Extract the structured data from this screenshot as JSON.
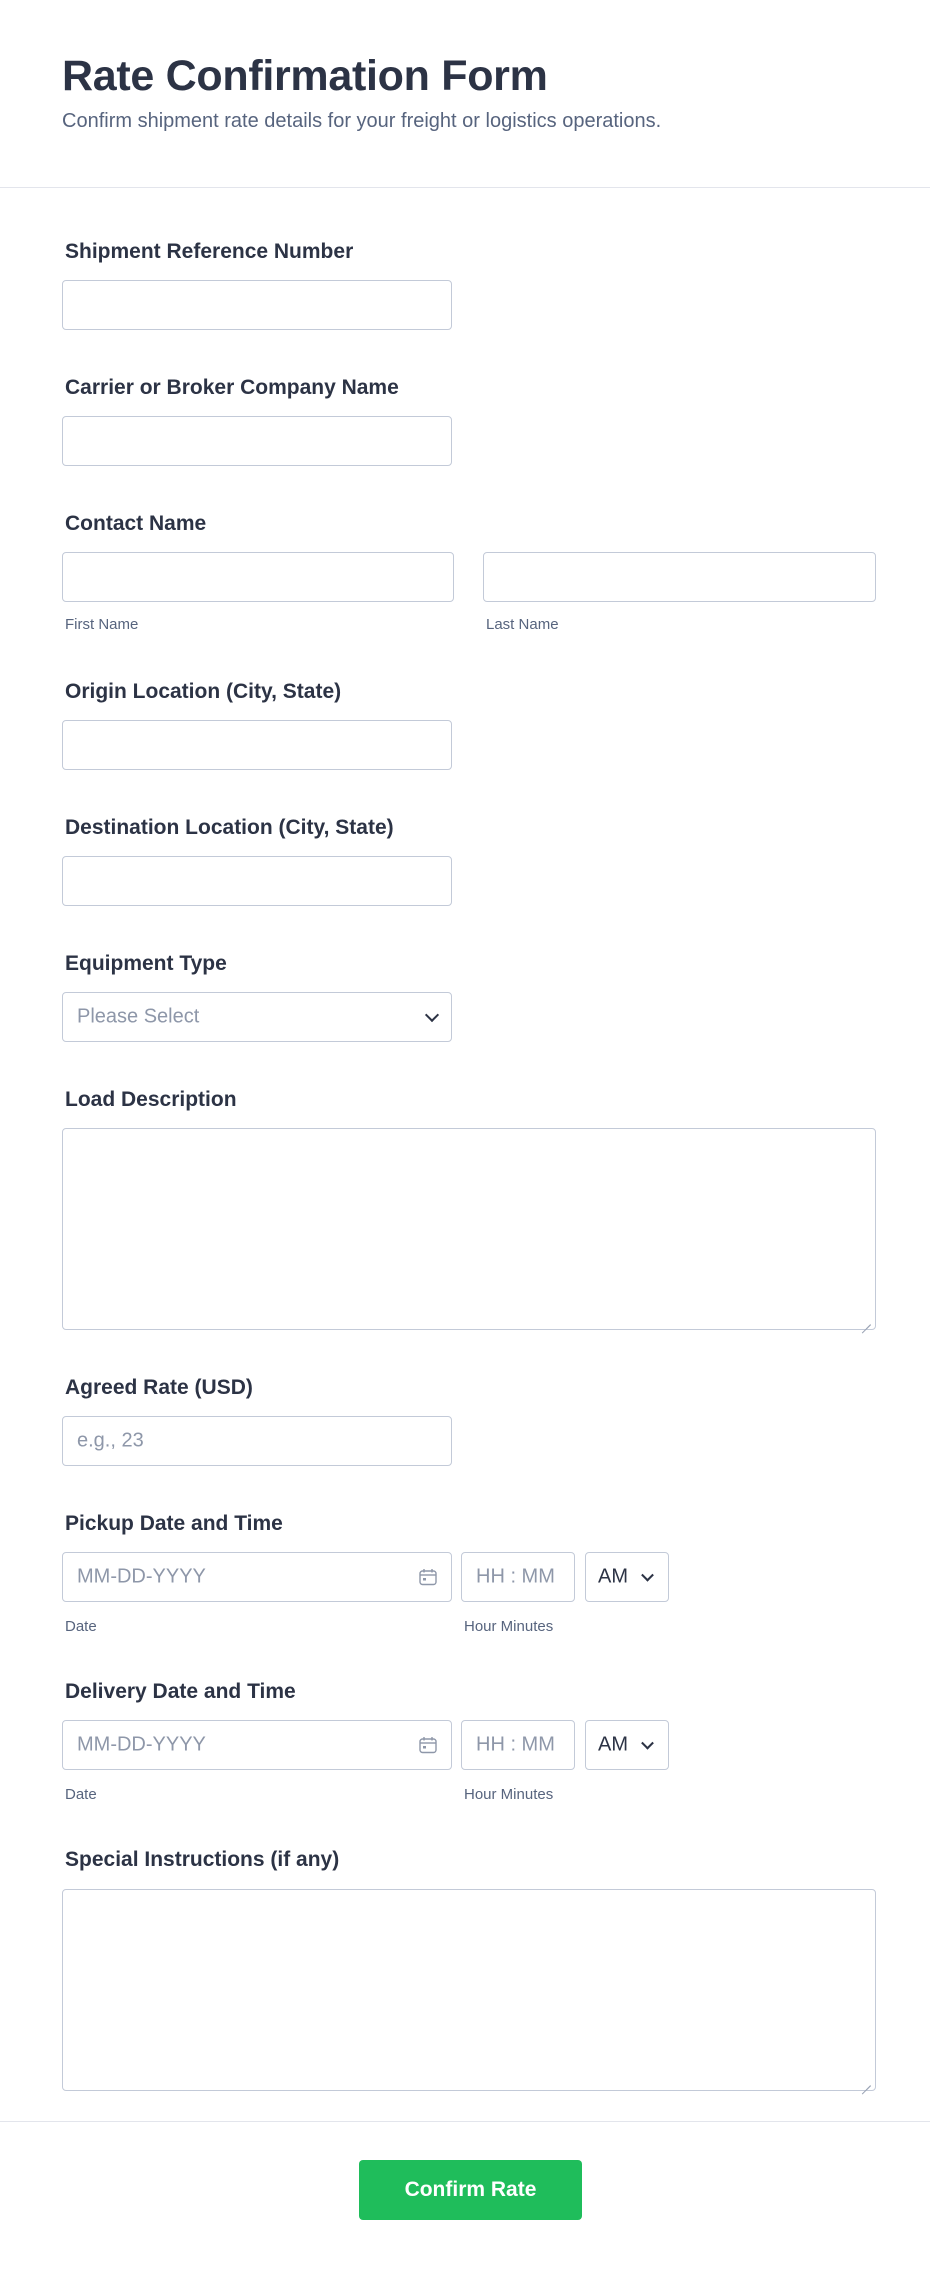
{
  "form": {
    "title": "Rate Confirmation Form",
    "subtitle": "Confirm shipment rate details for your freight or logistics operations."
  },
  "fields": {
    "shipment_ref": {
      "label": "Shipment Reference Number",
      "value": ""
    },
    "carrier": {
      "label": "Carrier or Broker Company Name",
      "value": ""
    },
    "contact": {
      "label": "Contact Name",
      "first_sublabel": "First Name",
      "last_sublabel": "Last Name",
      "first_value": "",
      "last_value": ""
    },
    "origin": {
      "label": "Origin Location (City, State)",
      "value": ""
    },
    "destination": {
      "label": "Destination Location (City, State)",
      "value": ""
    },
    "equipment": {
      "label": "Equipment Type",
      "placeholder": "Please Select",
      "icon": "chevron-down-icon"
    },
    "load_description": {
      "label": "Load Description",
      "value": ""
    },
    "agreed_rate": {
      "label": "Agreed Rate (USD)",
      "placeholder": "e.g., 23"
    },
    "pickup": {
      "label": "Pickup Date and Time",
      "date_placeholder": "MM-DD-YYYY",
      "time_placeholder": "HH : MM",
      "ampm": "AM",
      "date_sublabel": "Date",
      "time_sublabel": "Hour Minutes",
      "icon": "calendar-icon"
    },
    "delivery": {
      "label": "Delivery Date and Time",
      "date_placeholder": "MM-DD-YYYY",
      "time_placeholder": "HH : MM",
      "ampm": "AM",
      "date_sublabel": "Date",
      "time_sublabel": "Hour Minutes",
      "icon": "calendar-icon"
    },
    "special_instructions": {
      "label": "Special Instructions (if any)",
      "value": ""
    }
  },
  "submit": {
    "label": "Confirm Rate",
    "color": "#1fbd5b"
  },
  "colors": {
    "text": "#2c3345",
    "muted": "#57647e",
    "placeholder": "#8e97a9",
    "border": "#c3cad8"
  }
}
